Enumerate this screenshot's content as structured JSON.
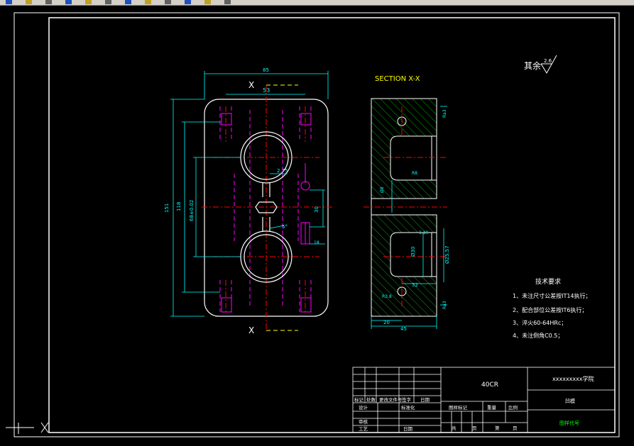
{
  "colors": {
    "background": "#000000",
    "outline": "#ffffff",
    "dimension": "#00ffff",
    "hidden": "#ff00ff",
    "center": "#ff0000",
    "hatch": "#00aa00",
    "text": "#ffff00",
    "green_text": "#00ff00"
  },
  "toolbar": {
    "icons": [
      "new-icon",
      "open-icon",
      "save-icon",
      "print-icon",
      "cut-icon",
      "copy-icon",
      "paste-icon",
      "undo-icon",
      "redo-icon",
      "zoom-icon",
      "properties-icon",
      "layer-icon"
    ]
  },
  "drawing": {
    "roughness": {
      "label": "其余",
      "value": "2.6"
    },
    "section_title": "SECTION X-X",
    "cut_label_top": "X",
    "cut_label_bottom": "X",
    "plan_dims": {
      "overall_width": "85",
      "top_spacing": "53",
      "overall_height": "151",
      "inner_height": "118",
      "hole_spacing": "68±0.02",
      "web_width": "2.75",
      "small_dim": "30",
      "angle": "5°",
      "pin_dim": "18"
    },
    "section_dims": {
      "bore": "Ø30",
      "pin_bore": "Ø25.57",
      "chamfer": "1.19",
      "bottom_width": "45",
      "bottom_left": "20",
      "bottom_right": "32",
      "small_hole": "Ø8",
      "radius": "R8",
      "ra_top": "Ra3",
      "ra_bot": "Ra3",
      "ra_mid": "R3.8"
    }
  },
  "tech_requirements": {
    "title": "技术要求",
    "items": [
      "1、未注尺寸公差按IT14执行；",
      "2、配合部位公差按IT6执行；",
      "3、淬火60-64HRc；",
      "4、未注倒角C0.5；"
    ]
  },
  "title_block": {
    "material": "40CR",
    "school": "xxxxxxxxx学院",
    "part_name": "凹模",
    "drawing_no": "图样代号",
    "row_labels": [
      "标记",
      "处数",
      "更改文件号",
      "签字",
      "日期"
    ],
    "designer": "设计",
    "standard": "标准化",
    "stage_label": "图样标记",
    "weight_label": "重量",
    "scale_label": "比例",
    "review": "审核",
    "process": "工艺",
    "date": "日期",
    "total_label": "共",
    "sheet_label": "页",
    "sheet_label2": "第",
    "page_label": "页"
  }
}
